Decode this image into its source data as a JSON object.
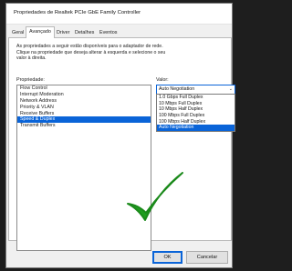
{
  "window": {
    "title": "Propriedades de Realtek PCIe GbE Family Controller"
  },
  "tabs": [
    {
      "label": "Geral",
      "active": false
    },
    {
      "label": "Avançado",
      "active": true
    },
    {
      "label": "Driver",
      "active": false
    },
    {
      "label": "Detalhes",
      "active": false
    },
    {
      "label": "Eventos",
      "active": false
    }
  ],
  "panel": {
    "description": "As propriedades a seguir estão disponíveis para o adaptador de rede. Clique na propriedade que deseja alterar à esquerda e selecione o seu valor à direita.",
    "property_label": "Propriedade:",
    "value_label": "Valor:"
  },
  "properties": [
    {
      "label": "Flow Control",
      "selected": false
    },
    {
      "label": "Interrupt Moderation",
      "selected": false
    },
    {
      "label": "Network Address",
      "selected": false
    },
    {
      "label": "Priority & VLAN",
      "selected": false
    },
    {
      "label": "Receive Buffers",
      "selected": false
    },
    {
      "label": "Speed & Duplex",
      "selected": true
    },
    {
      "label": "Transmit Buffers",
      "selected": false
    }
  ],
  "value_combo": {
    "current": "Auto Negotiation",
    "options": [
      {
        "label": "1.0 Gbps Full Duplex",
        "selected": false
      },
      {
        "label": "10 Mbps Full Duplex",
        "selected": false
      },
      {
        "label": "10 Mbps Half Duplex",
        "selected": false
      },
      {
        "label": "100 Mbps Full Duplex",
        "selected": false
      },
      {
        "label": "100 Mbps Half Duplex",
        "selected": false
      },
      {
        "label": "Auto Negotiation",
        "selected": true
      }
    ]
  },
  "overlay": {
    "icon": "checkmark-icon",
    "color": "#1f9e1f"
  },
  "buttons": {
    "ok_label": "OK",
    "cancel_label": "Cancelar"
  },
  "colors": {
    "selection": "#0a64d8",
    "dialog_bg": "#f0f0f0"
  }
}
